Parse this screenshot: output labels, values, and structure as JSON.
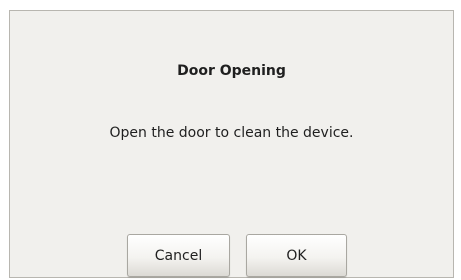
{
  "dialog": {
    "title": "Door Opening",
    "message": "Open the door to clean the device.",
    "cancel_label": "Cancel",
    "ok_label": "OK"
  }
}
